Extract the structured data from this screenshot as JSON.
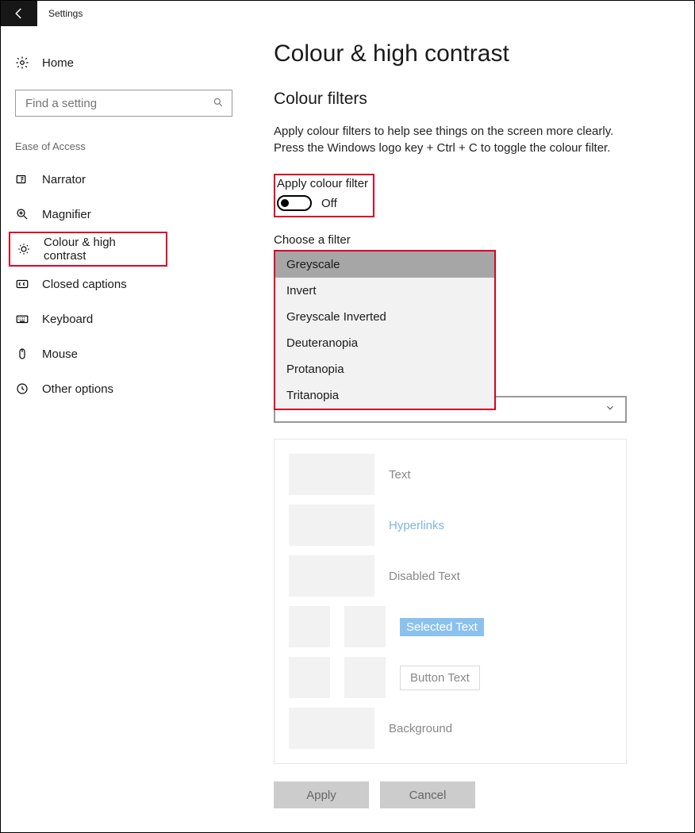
{
  "titlebar": {
    "title": "Settings"
  },
  "sidebar": {
    "home": "Home",
    "search_placeholder": "Find a setting",
    "category": "Ease of Access",
    "items": [
      {
        "label": "Narrator"
      },
      {
        "label": "Magnifier"
      },
      {
        "label": "Colour & high contrast",
        "highlighted": true
      },
      {
        "label": "Closed captions"
      },
      {
        "label": "Keyboard"
      },
      {
        "label": "Mouse"
      },
      {
        "label": "Other options"
      }
    ]
  },
  "main": {
    "heading": "Colour & high contrast",
    "section": "Colour filters",
    "description": "Apply colour filters to help see things on the screen more clearly. Press the Windows logo key + Ctrl + C to toggle the colour filter.",
    "toggle": {
      "label": "Apply colour filter",
      "state": "Off"
    },
    "choose_label": "Choose a filter",
    "filters": [
      "Greyscale",
      "Invert",
      "Greyscale Inverted",
      "Deuteranopia",
      "Protanopia",
      "Tritanopia"
    ],
    "selected_filter_index": 0,
    "preview": {
      "text": "Text",
      "hyperlinks": "Hyperlinks",
      "disabled": "Disabled Text",
      "selected": "Selected Text",
      "button": "Button Text",
      "background": "Background"
    },
    "buttons": {
      "apply": "Apply",
      "cancel": "Cancel"
    }
  }
}
